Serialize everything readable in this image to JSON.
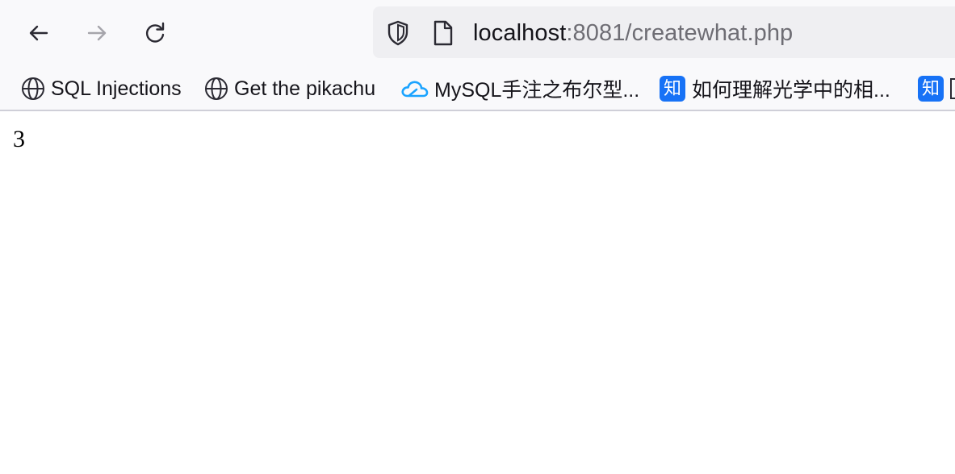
{
  "browser": {
    "url_host": "localhost",
    "url_rest": ":8081/createwhat.php",
    "back_icon": "arrow-left-icon",
    "forward_icon": "arrow-right-icon",
    "reload_icon": "reload-icon",
    "shield_icon": "shield-icon",
    "page_icon": "page-icon"
  },
  "bookmarks": [
    {
      "label": "SQL Injections",
      "icon": "globe-icon"
    },
    {
      "label": "Get the pikachu",
      "icon": "globe-icon"
    },
    {
      "label": "MySQL手注之布尔型...",
      "icon": "cloud-icon"
    },
    {
      "label": "如何理解光学中的相...",
      "icon": "zhihu-icon",
      "badge": "知"
    },
    {
      "label": "",
      "icon": "zhihu-icon",
      "badge": "知"
    }
  ],
  "page": {
    "body_text": "3"
  },
  "colors": {
    "toolbar_bg": "#f9f9fb",
    "urlbar_bg": "#efeff2",
    "zhihu_blue": "#1772f6",
    "cloud_blue": "#1aa3ff"
  }
}
